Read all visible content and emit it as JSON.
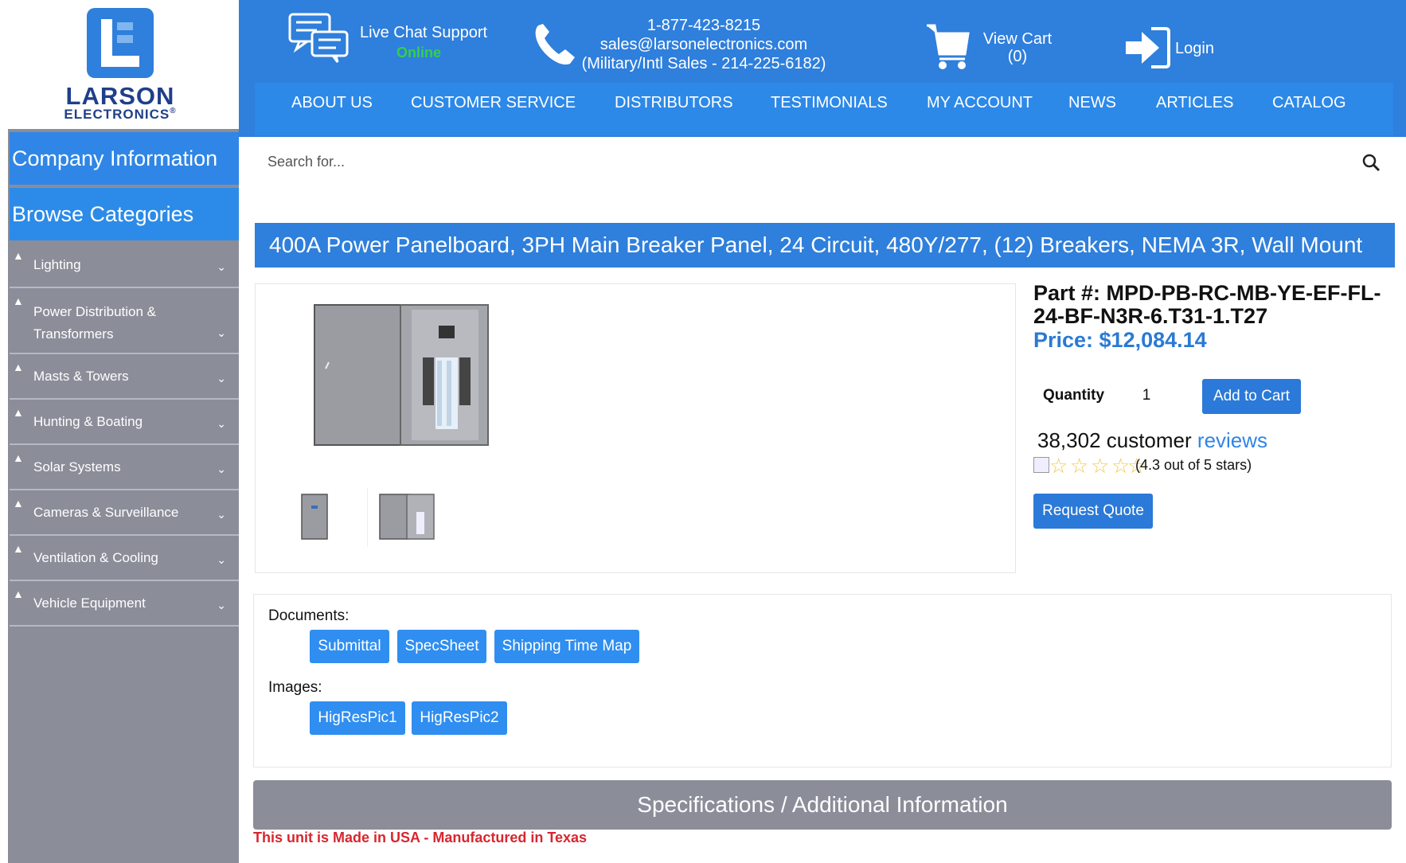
{
  "logo": {
    "name": "LARSON",
    "sub": "ELECTRONICS",
    "registered": "®"
  },
  "header": {
    "chat": {
      "label": "Live Chat Support",
      "status": "Online"
    },
    "contact": {
      "phone": "1-877-423-8215",
      "email": "sales@larsonelectronics.com",
      "military": "(Military/Intl Sales - 214-225-6182)"
    },
    "cart": {
      "label": "View Cart",
      "count": "(0)"
    },
    "login": "Login"
  },
  "nav": [
    "ABOUT US",
    "CUSTOMER SERVICE",
    "DISTRIBUTORS",
    "TESTIMONIALS",
    "MY ACCOUNT",
    "NEWS",
    "ARTICLES",
    "CATALOG"
  ],
  "search": {
    "placeholder": "Search for..."
  },
  "sidebar": {
    "company": "Company Information",
    "browse": "Browse Categories",
    "categories": [
      "Lighting",
      "Power Distribution & Transformers",
      "Masts & Towers",
      "Hunting & Boating",
      "Solar Systems",
      "Cameras & Surveillance",
      "Ventilation & Cooling",
      "Vehicle Equipment"
    ]
  },
  "product": {
    "title": "400A Power Panelboard, 3PH Main Breaker Panel, 24 Circuit, 480Y/277, (12) Breakers, NEMA 3R, Wall Mount",
    "part": "Part #: MPD-PB-RC-MB-YE-EF-FL-24-BF-N3R-6.T31-1.T27",
    "price": "Price: $12,084.14",
    "quantity_label": "Quantity",
    "quantity_value": "1",
    "add_to_cart": "Add to Cart",
    "reviews_count": "38,302 customer",
    "reviews_link": "reviews",
    "rating_text": "(4.3 out of 5 stars)",
    "rating": 4.3,
    "request_quote": "Request Quote"
  },
  "documents": {
    "label": "Documents:",
    "buttons": [
      "Submittal",
      "SpecSheet",
      "Shipping Time Map"
    ],
    "images_label": "Images:",
    "image_buttons": [
      "HigResPic1",
      "HigResPic2"
    ]
  },
  "specs": {
    "bar": "Specifications / Additional Information",
    "made": "This unit is Made in USA - Manufactured in Texas"
  },
  "colors": {
    "brand_blue": "#2f7fdc",
    "sidebar_gray": "#8b8d99",
    "price_blue": "#2a7ad3",
    "online_green": "#33d04a",
    "made_red": "#d8262e"
  }
}
